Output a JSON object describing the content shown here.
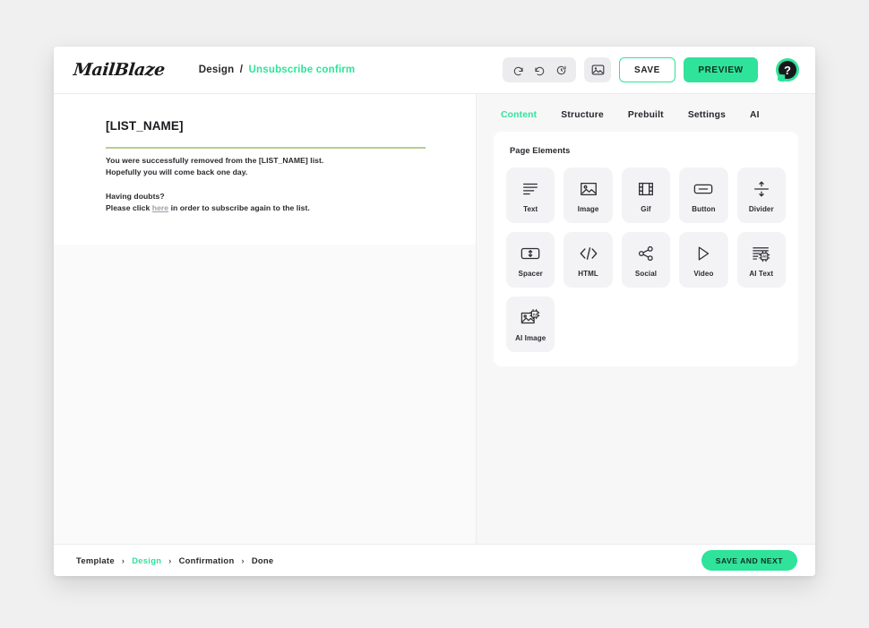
{
  "header": {
    "logo_text": "MailBlaze",
    "breadcrumb": {
      "parent": "Design",
      "separator": "/",
      "current": "Unsubscribe confirm"
    },
    "history": {
      "undo_label": "undo-icon",
      "redo_label": "redo-icon",
      "restore_label": "restore-history-icon"
    },
    "image_button_label": "image-icon",
    "save_label": "SAVE",
    "preview_label": "PREVIEW",
    "help_label": "?"
  },
  "canvas": {
    "email": {
      "title": "[LIST_NAME]",
      "line1": "You were successfully removed from the [LIST_NAME] list.",
      "line2": "Hopefully you will come back one day.",
      "line3": "Having doubts?",
      "line4_prefix": "Please click ",
      "line4_link": "here",
      "line4_suffix": " in order to subscribe again to the list."
    }
  },
  "sidebar": {
    "tabs": [
      {
        "label": "Content",
        "active": true
      },
      {
        "label": "Structure",
        "active": false
      },
      {
        "label": "Prebuilt",
        "active": false
      },
      {
        "label": "Settings",
        "active": false
      },
      {
        "label": "AI",
        "active": false
      }
    ],
    "panel_title": "Page Elements",
    "elements": [
      {
        "label": "Text",
        "icon": "text-lines-icon"
      },
      {
        "label": "Image",
        "icon": "image-icon"
      },
      {
        "label": "Gif",
        "icon": "film-strip-icon"
      },
      {
        "label": "Button",
        "icon": "button-icon"
      },
      {
        "label": "Divider",
        "icon": "divider-icon"
      },
      {
        "label": "Spacer",
        "icon": "spacer-icon"
      },
      {
        "label": "HTML",
        "icon": "code-icon"
      },
      {
        "label": "Social",
        "icon": "share-icon"
      },
      {
        "label": "Video",
        "icon": "play-icon"
      },
      {
        "label": "AI Text",
        "icon": "ai-text-icon"
      },
      {
        "label": "AI Image",
        "icon": "ai-image-icon"
      }
    ]
  },
  "footer": {
    "steps": [
      {
        "label": "Template",
        "active": false
      },
      {
        "label": "Design",
        "active": true
      },
      {
        "label": "Confirmation",
        "active": false
      },
      {
        "label": "Done",
        "active": false
      }
    ],
    "separator": "›",
    "save_next_label": "SAVE AND NEXT"
  },
  "colors": {
    "accent_green": "#2fe39a",
    "rule_green": "#b6cd8f",
    "panel_bg": "#f7f7f8",
    "card_bg": "#f3f3f5",
    "text_dark": "#27272b"
  }
}
